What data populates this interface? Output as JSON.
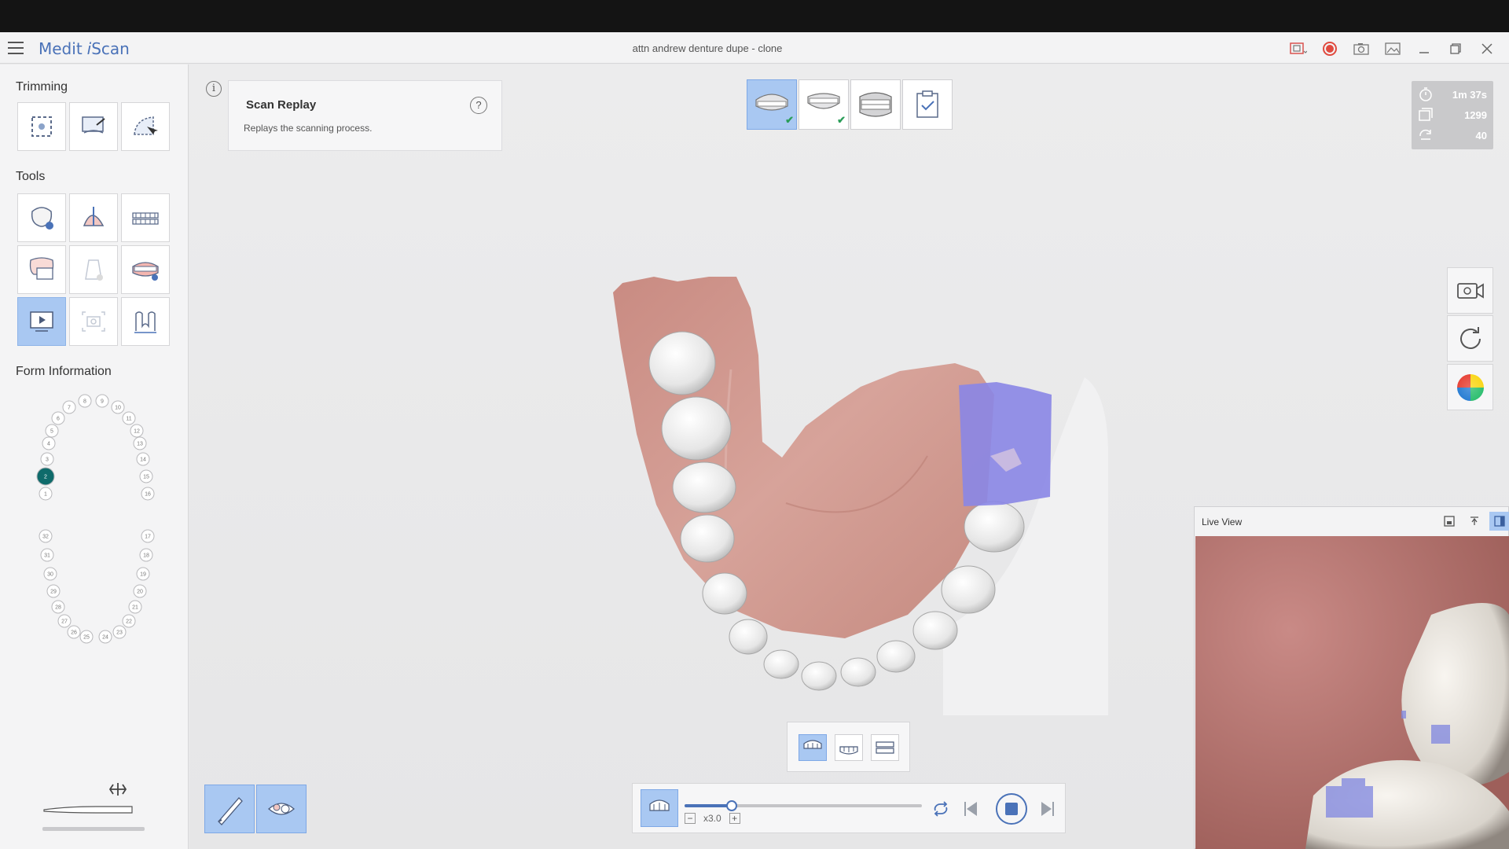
{
  "app": {
    "brand": "Medit",
    "brand_suffix": "Scan",
    "doc_title": "attn andrew denture dupe - clone"
  },
  "sidebar": {
    "trimming_title": "Trimming",
    "tools_title": "Tools",
    "form_title": "Form Information",
    "teeth_upper": [
      "8",
      "9",
      "7",
      "10",
      "6",
      "11",
      "5",
      "12",
      "4",
      "13",
      "3",
      "14",
      "2",
      "15",
      "1",
      "16"
    ],
    "teeth_lower": [
      "32",
      "17",
      "31",
      "18",
      "30",
      "19",
      "29",
      "20",
      "28",
      "21",
      "27",
      "22",
      "26",
      "23",
      "25",
      "24"
    ],
    "selected_tooth": "2"
  },
  "replay": {
    "title": "Scan Replay",
    "description": "Replays the scanning process.",
    "help": "?"
  },
  "info_icon": "i",
  "stats": {
    "time": "1m 37s",
    "frames": "1299",
    "rotations": "40"
  },
  "liveview": {
    "title": "Live View"
  },
  "player": {
    "speed": "x3.0",
    "progress": 0.2
  },
  "colors": {
    "accent": "#4a72b8",
    "active_bg": "#a9c8f2",
    "check": "#2a9d58",
    "record": "#e04a3f",
    "scan_overlay": "#8a86e6"
  }
}
